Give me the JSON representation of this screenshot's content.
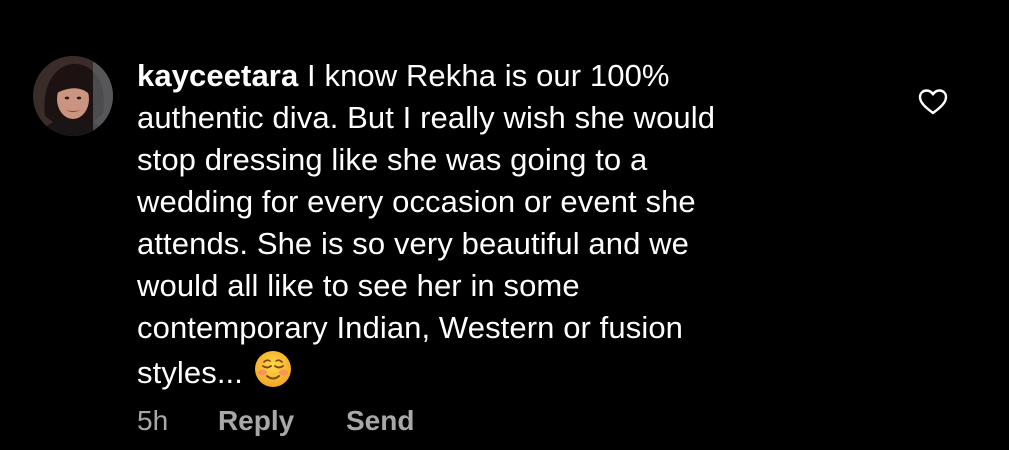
{
  "comment": {
    "username": "kayceetara",
    "text_lines": [
      " I know Rekha is our 100%",
      "authentic diva. But I really wish she would",
      "stop dressing like she was going to a",
      "wedding for every occasion or event she",
      "attends. She is so very beautiful and we",
      "would all like to see her in some",
      "contemporary Indian, Western or fusion",
      "styles..."
    ],
    "emoji": "smiling-face-emoji",
    "like_icon": "heart-outline-icon"
  },
  "actions": {
    "time": "5h",
    "reply_label": "Reply",
    "send_label": "Send"
  },
  "colors": {
    "background": "#000000",
    "text": "#ffffff",
    "secondary_text": "#a8a8a8"
  }
}
